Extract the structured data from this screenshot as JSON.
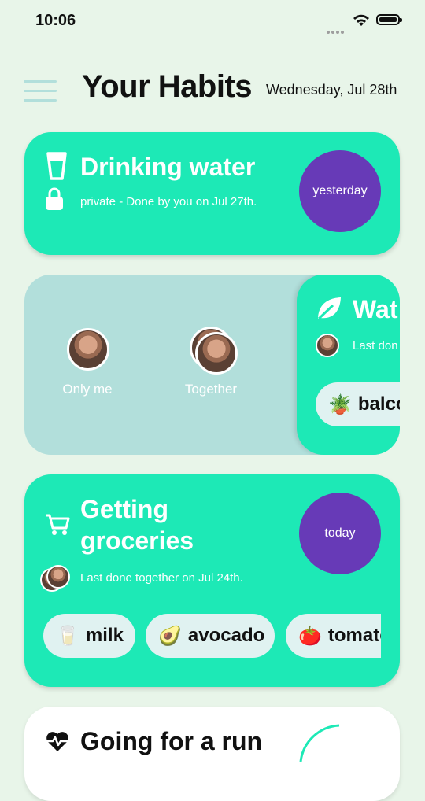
{
  "status_bar": {
    "time": "10:06"
  },
  "header": {
    "title": "Your Habits",
    "date": "Wednesday, Jul 28th"
  },
  "habits": [
    {
      "name": "Drinking water",
      "subtitle": "private - Done by you on Jul 27th.",
      "badge": "yesterday",
      "icon": "glass-icon",
      "lock_icon": "lock-icon"
    },
    {
      "sharing": {
        "options": [
          "Only me",
          "Together"
        ]
      },
      "peek": {
        "name": "Wat",
        "subtitle": "Last don",
        "tag": {
          "emoji": "🪴",
          "label": "balco"
        },
        "icon": "leaf-icon"
      }
    },
    {
      "name_line1": "Getting",
      "name_line2": "groceries",
      "subtitle": "Last done together on Jul 24th.",
      "badge": "today",
      "icon": "cart-icon",
      "items": [
        {
          "emoji": "🥛",
          "label": "milk"
        },
        {
          "emoji": "🥑",
          "label": "avocado"
        },
        {
          "emoji": "🍅",
          "label": "tomato"
        }
      ]
    },
    {
      "name": "Going for a run",
      "icon": "heartbeat-icon"
    }
  ],
  "colors": {
    "card": "#1de9b6",
    "badge": "#673ab7",
    "background": "#e8f5e9",
    "share_panel": "#b2dfdb"
  }
}
